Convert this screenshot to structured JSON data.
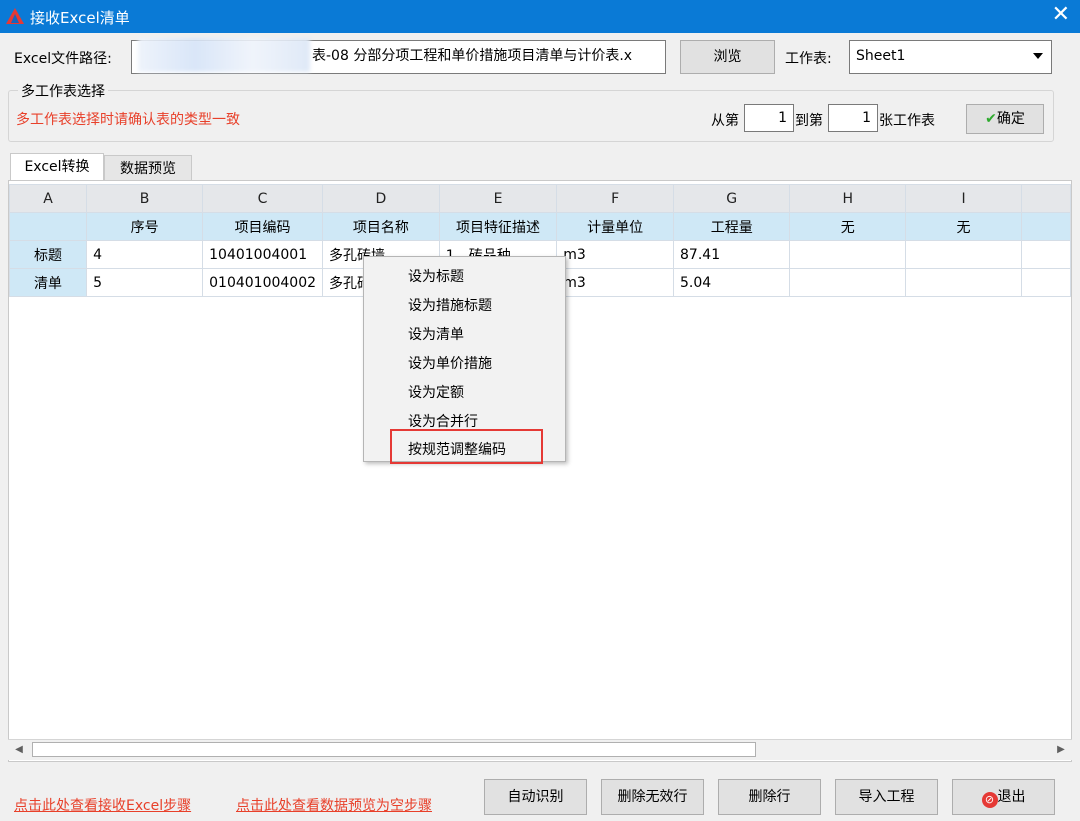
{
  "window": {
    "title": "接收Excel清单",
    "close_glyph": "✕"
  },
  "path": {
    "label": "Excel文件路径:",
    "value": "表-08 分部分项工程和单价措施项目清单与计价表.x",
    "browse_label": "浏览"
  },
  "sheet": {
    "label": "工作表:",
    "selected": "Sheet1"
  },
  "multi": {
    "legend": "多工作表选择",
    "warning": "多工作表选择时请确认表的类型一致",
    "from_label": "从第",
    "from_value": "1",
    "to_label": "到第",
    "to_value": "1",
    "suffix": "张工作表",
    "confirm_label": "确定"
  },
  "tabs": [
    "Excel转换",
    "数据预览"
  ],
  "grid": {
    "columns": [
      "A",
      "B",
      "C",
      "D",
      "E",
      "F",
      "G",
      "H",
      "I"
    ],
    "field_headers": [
      "",
      "序号",
      "项目编码",
      "项目名称",
      "项目特征描述",
      "计量单位",
      "工程量",
      "无",
      "无"
    ],
    "rows": [
      {
        "type": "标题",
        "cells": [
          "4",
          "10401004001",
          "多孔砖墙",
          "1、砖品种",
          "m3",
          "87.41",
          "",
          ""
        ]
      },
      {
        "type": "清单",
        "cells": [
          "5",
          "010401004002",
          "多孔砖",
          "",
          "m3",
          "5.04",
          "",
          ""
        ]
      }
    ]
  },
  "context_menu": [
    "设为标题",
    "设为措施标题",
    "设为清单",
    "设为单价措施",
    "设为定额",
    "设为合并行",
    "按规范调整编码"
  ],
  "footer": {
    "link_steps": "点击此处查看接收Excel步骤",
    "link_empty": "点击此处查看数据预览为空步骤",
    "buttons": {
      "auto": "自动识别",
      "del_invalid": "删除无效行",
      "del_row": "删除行",
      "import": "导入工程",
      "exit": "退出"
    }
  },
  "colors": {
    "titlebar": "#0a7ad6",
    "warning": "#e8402a",
    "header_blue": "#cfe8f6",
    "highlight": "#e53935"
  }
}
